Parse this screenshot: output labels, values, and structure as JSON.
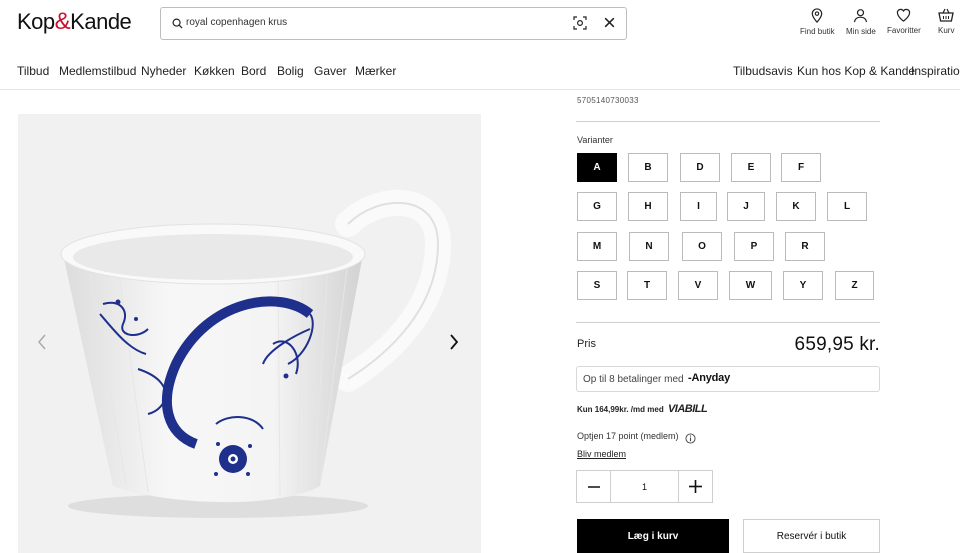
{
  "header": {
    "logo_left": "Kop",
    "logo_amp": "&",
    "logo_right": "Kande",
    "search_value": "royal copenhagen krus",
    "icons": [
      {
        "name": "find-store-icon",
        "label": "Find butik"
      },
      {
        "name": "user-icon",
        "label": "Min side"
      },
      {
        "name": "heart-icon",
        "label": "Favoritter"
      },
      {
        "name": "basket-icon",
        "label": "Kurv"
      }
    ]
  },
  "nav": {
    "left": [
      "Tilbud",
      "Medlemstilbud",
      "Nyheder",
      "Køkken",
      "Bord",
      "Bolig",
      "Gaver",
      "Mærker"
    ],
    "right": [
      "Tilbudsavis",
      "Kun hos Kop & Kande",
      "Inspiration"
    ]
  },
  "product": {
    "ean": "5705140730033",
    "variants_label": "Varianter",
    "variants_rows": [
      [
        "A",
        "B",
        "D",
        "E",
        "F"
      ],
      [
        "G",
        "H",
        "I",
        "J",
        "K",
        "L"
      ],
      [
        "M",
        "N",
        "O",
        "P",
        "R"
      ],
      [
        "S",
        "T",
        "V",
        "W",
        "Y",
        "Z"
      ]
    ],
    "selected_variant": "A",
    "price_label": "Pris",
    "price": "659,95 kr.",
    "anyday_text": "Op til 8 betalinger med",
    "anyday_brand": "-Anyday",
    "viabill_text": "Kun 164,99kr. /md med",
    "viabill_brand": "VIABILL",
    "points_text": "Optjen 17 point (medlem)",
    "become_member": "Bliv medlem",
    "quantity": "1",
    "add_to_cart": "Læg i kurv",
    "reserve": "Reservér i butik"
  },
  "colors": {
    "accent": "#000000",
    "brand_red": "#c8102e",
    "pattern_blue": "#1f2f8c"
  }
}
